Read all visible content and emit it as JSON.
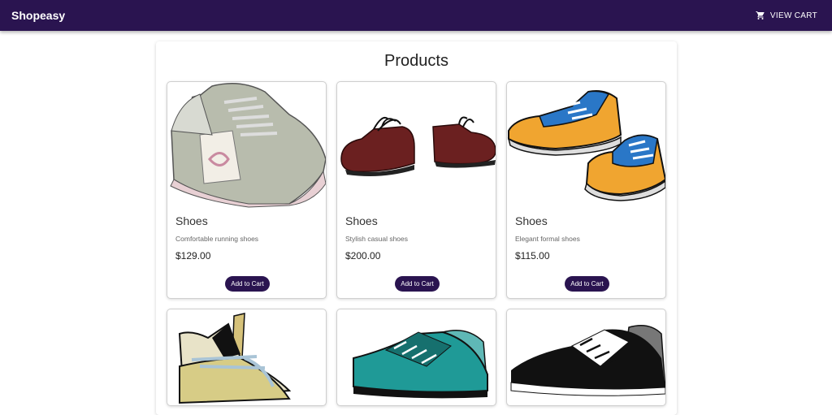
{
  "header": {
    "brand": "Shopeasy",
    "cart_label": "VIEW CART",
    "colors": {
      "bar": "#2a1450",
      "text": "#ffffff"
    }
  },
  "main": {
    "title": "Products",
    "products": [
      {
        "name": "Shoes",
        "description": "Comfortable running shoes",
        "price": "$129.00",
        "button": "Add to Cart",
        "image": "gray-running-sneakers"
      },
      {
        "name": "Shoes",
        "description": "Stylish casual shoes",
        "price": "$200.00",
        "button": "Add to Cart",
        "image": "brown-casual-shoes"
      },
      {
        "name": "Shoes",
        "description": "Elegant formal shoes",
        "price": "$115.00",
        "button": "Add to Cart",
        "image": "blue-orange-sneakers"
      },
      {
        "image": "yellow-sneaker"
      },
      {
        "image": "teal-sneakers"
      },
      {
        "image": "black-white-sneakers"
      }
    ]
  }
}
